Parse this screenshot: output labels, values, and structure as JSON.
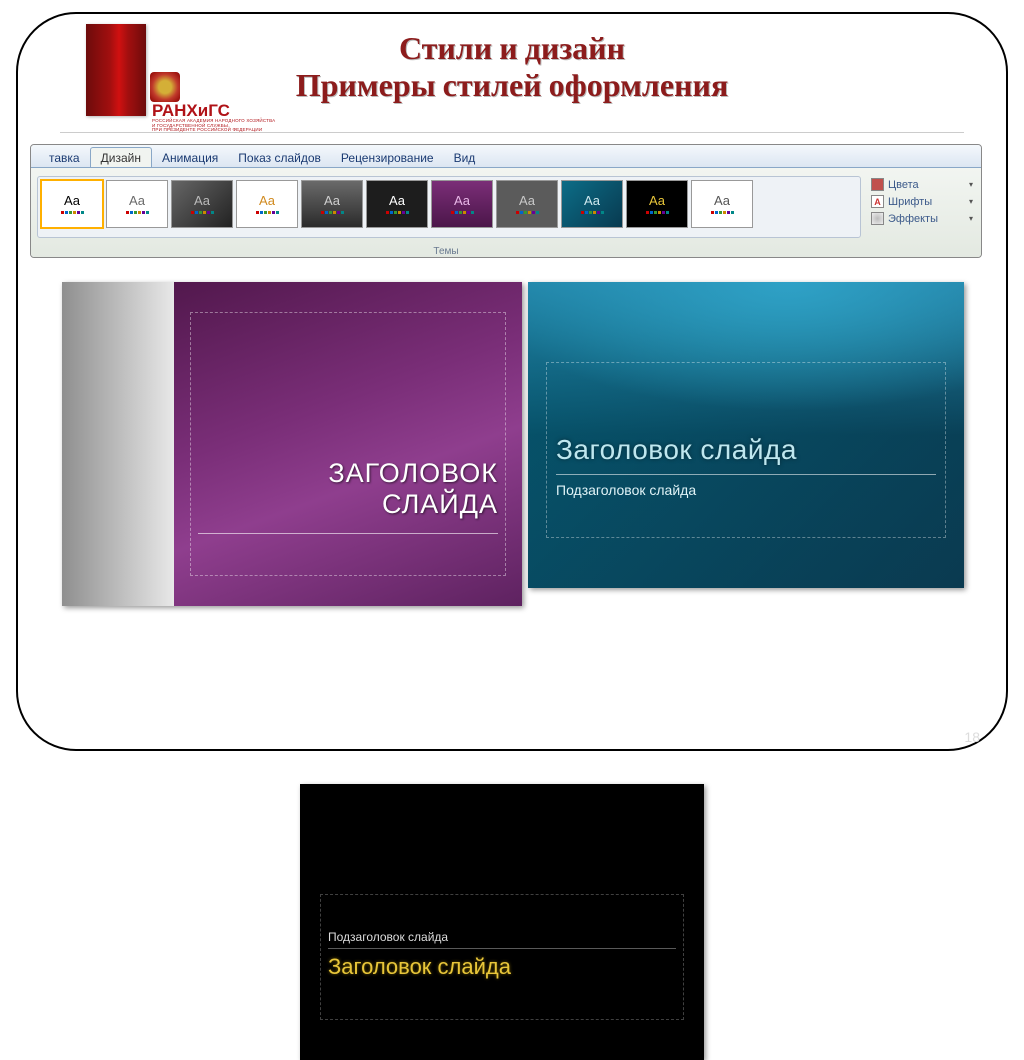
{
  "pagenum": "18",
  "title": {
    "l1": "Стили и дизайн",
    "l2": "Примеры стилей оформления"
  },
  "logo": {
    "main": "РАНХиГС",
    "sub1": "РОССИЙСКАЯ АКАДЕМИЯ НАРОДНОГО ХОЗЯЙСТВА",
    "sub2": "И ГОСУДАРСТВЕННОЙ СЛУЖБЫ",
    "sub3": "ПРИ ПРЕЗИДЕНТЕ РОССИЙСКОЙ ФЕДЕРАЦИИ"
  },
  "tabs": [
    {
      "label": "тавка",
      "active": false
    },
    {
      "label": "Дизайн",
      "active": true
    },
    {
      "label": "Анимация",
      "active": false
    },
    {
      "label": "Показ слайдов",
      "active": false
    },
    {
      "label": "Рецензирование",
      "active": false
    },
    {
      "label": "Вид",
      "active": false
    }
  ],
  "group_label": "Темы",
  "side": [
    {
      "label": "Цвета",
      "swatch": "#c0504d"
    },
    {
      "label": "Шрифты",
      "swatch": "#ffffff"
    },
    {
      "label": "Эффекты",
      "swatch": "#ffffff"
    }
  ],
  "themes": [
    {
      "bg": "#ffffff",
      "fg": "#000000",
      "selected": true
    },
    {
      "bg": "#ffffff",
      "fg": "#6a6a6a",
      "selected": false
    },
    {
      "bg": "linear-gradient(135deg,#666,#222)",
      "fg": "#bbbbbb",
      "selected": false
    },
    {
      "bg": "#ffffff",
      "fg": "#d08a1f",
      "selected": false
    },
    {
      "bg": "linear-gradient(#6a6a6a,#2b2b2b)",
      "fg": "#cfcfcf",
      "selected": false
    },
    {
      "bg": "#1d1d1d",
      "fg": "#ffffff",
      "selected": false
    },
    {
      "bg": "linear-gradient(#7b2e78,#4b164a)",
      "fg": "#e9b8e8",
      "selected": false
    },
    {
      "bg": "#5b5b5b",
      "fg": "#c9c9c9",
      "selected": false
    },
    {
      "bg": "linear-gradient(135deg,#0c6d87,#083a50)",
      "fg": "#cfe9ef",
      "selected": false
    },
    {
      "bg": "#000000",
      "fg": "#e8c63a",
      "selected": false
    },
    {
      "bg": "#ffffff",
      "fg": "#555555",
      "selected": false
    }
  ],
  "pv1": {
    "t1": "ЗАГОЛОВОК",
    "t1b": "СЛАЙДА"
  },
  "pv2": {
    "t1": "Заголовок слайда",
    "t2": "Подзаголовок слайда"
  },
  "pv3": {
    "t1": "Заголовок слайда",
    "t2": "Подзаголовок слайда"
  },
  "aa": "Aa",
  "fonts_a": "A",
  "dots": [
    "#c00",
    "#06c",
    "#393",
    "#c80",
    "#609",
    "#088"
  ]
}
